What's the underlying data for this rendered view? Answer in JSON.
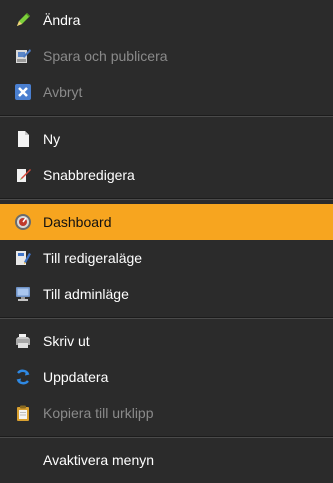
{
  "menu": {
    "groups": [
      {
        "items": [
          {
            "label": "Ändra",
            "icon": "pencil-icon",
            "disabled": false,
            "active": false
          },
          {
            "label": "Spara och publicera",
            "icon": "save-publish-icon",
            "disabled": true,
            "active": false
          },
          {
            "label": "Avbryt",
            "icon": "cancel-icon",
            "disabled": true,
            "active": false
          }
        ]
      },
      {
        "items": [
          {
            "label": "Ny",
            "icon": "new-page-icon",
            "disabled": false,
            "active": false
          },
          {
            "label": "Snabbredigera",
            "icon": "quick-edit-icon",
            "disabled": false,
            "active": false
          }
        ]
      },
      {
        "items": [
          {
            "label": "Dashboard",
            "icon": "dashboard-icon",
            "disabled": false,
            "active": true
          },
          {
            "label": "Till redigeraläge",
            "icon": "edit-mode-icon",
            "disabled": false,
            "active": false
          },
          {
            "label": "Till adminläge",
            "icon": "admin-mode-icon",
            "disabled": false,
            "active": false
          }
        ]
      },
      {
        "items": [
          {
            "label": "Skriv ut",
            "icon": "printer-icon",
            "disabled": false,
            "active": false
          },
          {
            "label": "Uppdatera",
            "icon": "refresh-icon",
            "disabled": false,
            "active": false
          },
          {
            "label": "Kopiera till urklipp",
            "icon": "clipboard-icon",
            "disabled": true,
            "active": false
          }
        ]
      },
      {
        "items": [
          {
            "label": "Avaktivera menyn",
            "icon": "",
            "disabled": false,
            "active": false
          }
        ]
      }
    ]
  },
  "colors": {
    "background": "#2b2b2b",
    "highlight": "#f7a51f",
    "text": "#ffffff",
    "disabled_text": "#8a8a8a"
  }
}
